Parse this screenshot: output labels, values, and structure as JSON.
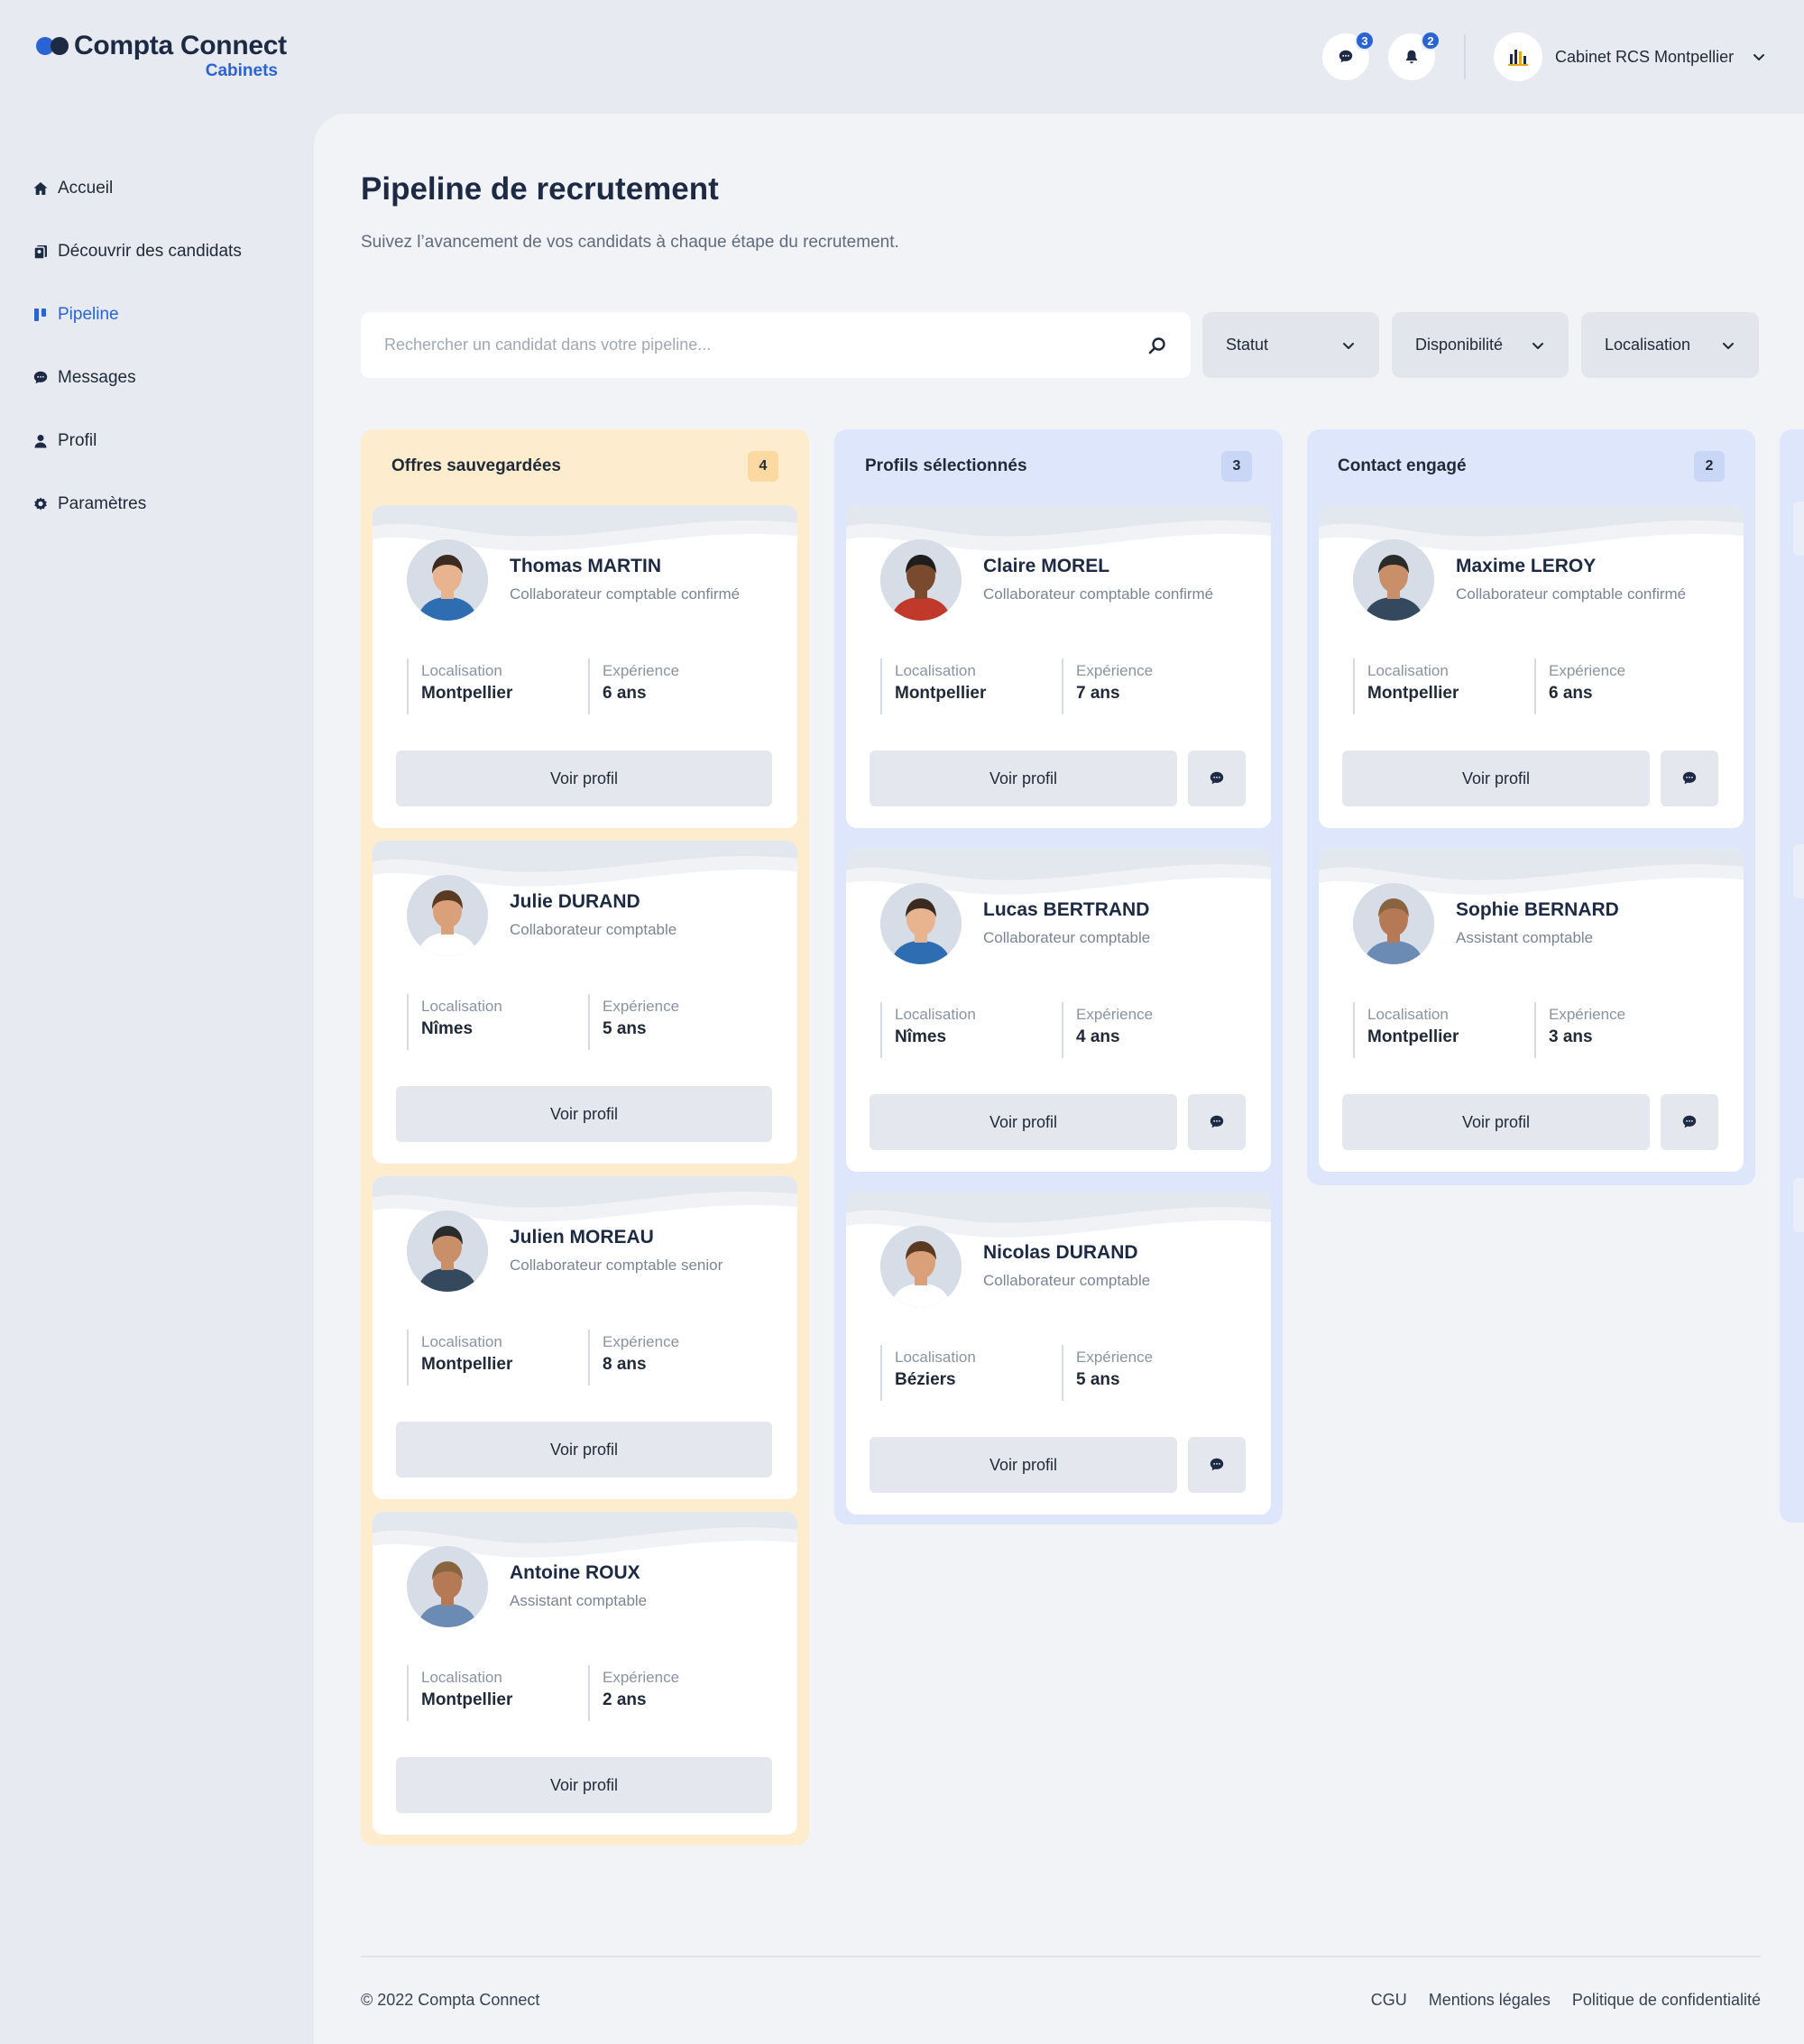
{
  "brand": {
    "name": "Compta Connect",
    "sub": "Cabinets",
    "colors": {
      "primary": "#2a63d4",
      "dark": "#1d2a44"
    }
  },
  "header": {
    "messages": {
      "icon": "chat-icon",
      "count": "3"
    },
    "notifications": {
      "icon": "bell-icon",
      "count": "2"
    },
    "account": {
      "name": "Cabinet RCS Montpellier",
      "icon": "building-logo-icon"
    }
  },
  "sidebar": {
    "items": [
      {
        "label": "Accueil",
        "icon": "home-icon"
      },
      {
        "label": "Découvrir des candidats",
        "icon": "cards-icon"
      },
      {
        "label": "Pipeline",
        "icon": "pipeline-icon",
        "active": true
      },
      {
        "label": "Messages",
        "icon": "chat-icon"
      },
      {
        "label": "Profil",
        "icon": "user-icon"
      },
      {
        "label": "Paramètres",
        "icon": "gear-icon"
      }
    ]
  },
  "page": {
    "title": "Pipeline de recrutement",
    "subtitle": "Suivez l’avancement de vos candidats à chaque étape du recrutement."
  },
  "search": {
    "placeholder": "Rechercher un candidat dans votre pipeline..."
  },
  "filters": {
    "status": "Statut",
    "availability": "Disponibilité",
    "location": "Localisation"
  },
  "labels": {
    "location": "Localisation",
    "experience": "Expérience",
    "view_profile": "Voir profil"
  },
  "columns": [
    {
      "title": "Offres sauvegardées",
      "count": "4",
      "color": "#fdecce",
      "cards": [
        {
          "name": "Thomas MARTIN",
          "role": "Collaborateur comptable confirmé",
          "location": "Montpellier",
          "experience": "6 ans"
        },
        {
          "name": "Julie DURAND",
          "role": "Collaborateur comptable",
          "location": "Nîmes",
          "experience": "5 ans"
        },
        {
          "name": "Julien MOREAU",
          "role": "Collaborateur comptable senior",
          "location": "Montpellier",
          "experience": "8 ans"
        },
        {
          "name": "Antoine ROUX",
          "role": "Assistant comptable",
          "location": "Montpellier",
          "experience": "2 ans"
        }
      ]
    },
    {
      "title": "Profils sélectionnés",
      "count": "3",
      "color": "#dde6fb",
      "cards": [
        {
          "name": "Claire MOREL",
          "role": "Collaborateur comptable confirmé",
          "location": "Montpellier",
          "experience": "7 ans"
        },
        {
          "name": "Lucas BERTRAND",
          "role": "Collaborateur comptable",
          "location": "Nîmes",
          "experience": "4 ans"
        },
        {
          "name": "Nicolas DURAND",
          "role": "Collaborateur comptable",
          "location": "Béziers",
          "experience": "5 ans"
        }
      ]
    },
    {
      "title": "Contact engagé",
      "count": "2",
      "color": "#dde6fb",
      "cards": [
        {
          "name": "Maxime LEROY",
          "role": "Collaborateur comptable confirmé",
          "location": "Montpellier",
          "experience": "6 ans"
        },
        {
          "name": "Sophie BERNARD",
          "role": "Assistant comptable",
          "location": "Montpellier",
          "experience": "3 ans"
        }
      ]
    }
  ],
  "footer": {
    "copyright": "© 2022 Compta Connect",
    "links": [
      "CGU",
      "Mentions légales",
      "Politique de confidentialité"
    ]
  }
}
